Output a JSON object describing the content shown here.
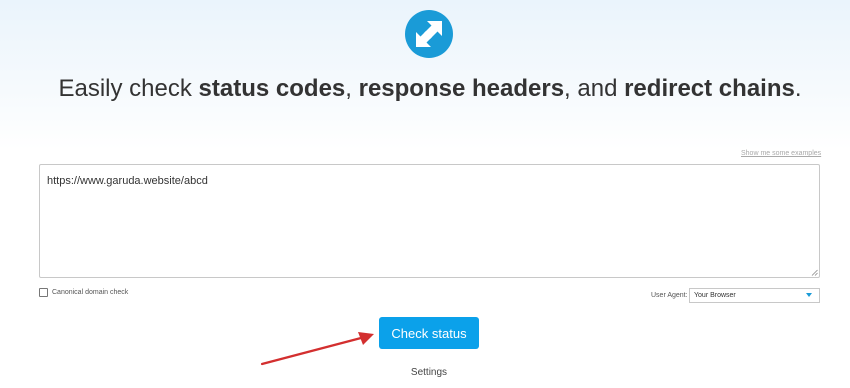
{
  "header": {
    "logo_icon": "transfer-arrows-icon",
    "headline": {
      "part1": "Easily check ",
      "bold1": "status codes",
      "part2": ", ",
      "bold2": "response headers",
      "part3": ", and ",
      "bold3": "redirect chains",
      "part4": "."
    }
  },
  "form": {
    "examples_link": "Show me some examples",
    "url_input_value": "https://www.garuda.website/abcd",
    "canonical_label": "Canonical domain check",
    "canonical_checked": false,
    "user_agent_label": "User Agent:",
    "user_agent_value": "Your Browser",
    "submit_label": "Check status",
    "settings_label": "Settings"
  },
  "annotation": {
    "arrow_color": "#d32f2f"
  },
  "colors": {
    "accent": "#0ba1ea",
    "logo": "#1a9bd7"
  }
}
